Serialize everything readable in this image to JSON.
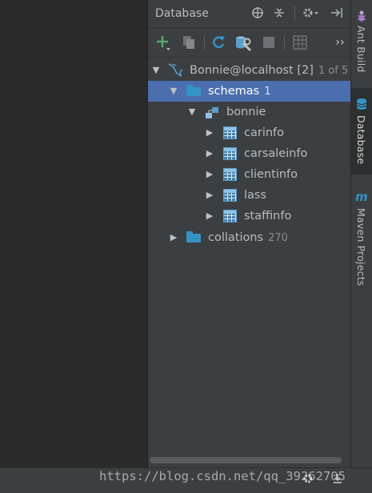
{
  "panel": {
    "title": "Database",
    "header_icons": [
      "target-icon",
      "collapse-icon",
      "gear-icon",
      "hide-icon"
    ],
    "toolbar_more": "››"
  },
  "tree": {
    "connection": {
      "label": "Bonnie@localhost [2]",
      "count": "1 of 5"
    },
    "schemas": {
      "label": "schemas",
      "count": "1"
    },
    "schema": {
      "label": "bonnie"
    },
    "tables": [
      "carinfo",
      "carsaleinfo",
      "clientinfo",
      "lass",
      "staffinfo"
    ],
    "collations": {
      "label": "collations",
      "count": "270"
    }
  },
  "strip": {
    "ant_build": "Ant Build",
    "database": "Database",
    "maven": "Maven Projects"
  },
  "watermark": "https://blog.csdn.net/qq_39262705",
  "colors": {
    "panel_bg": "#3c3f41",
    "selected_bg": "#4b6eaf",
    "editor_bg": "#2b2b2b",
    "folder_blue": "#3592c4",
    "add_green": "#59a869",
    "refresh_blue": "#3592c4"
  }
}
